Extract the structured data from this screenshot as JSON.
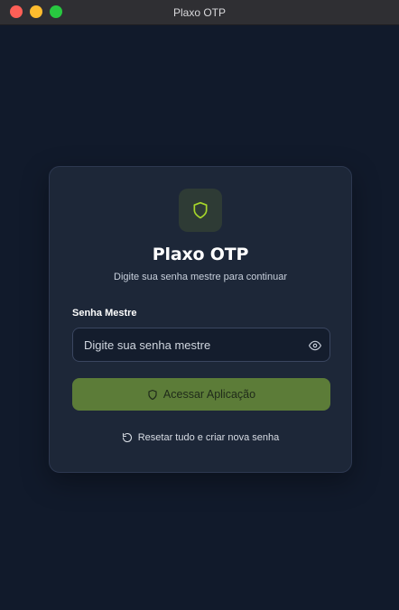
{
  "window": {
    "title": "Plaxo OTP"
  },
  "card": {
    "logo_icon": "shield-icon",
    "title": "Plaxo OTP",
    "subtitle": "Digite sua senha mestre para continuar",
    "password_label": "Senha Mestre",
    "password_placeholder": "Digite sua senha mestre",
    "password_value": "",
    "toggle_visibility_icon": "eye-icon",
    "submit_label": "Acessar Aplicação",
    "submit_icon": "shield-icon",
    "reset_label": "Resetar tudo e criar nova senha",
    "reset_icon": "refresh-icon"
  },
  "colors": {
    "background": "#111a2b",
    "card": "#1d2738",
    "accent": "#a6d62a",
    "button": "#5c7c38"
  }
}
